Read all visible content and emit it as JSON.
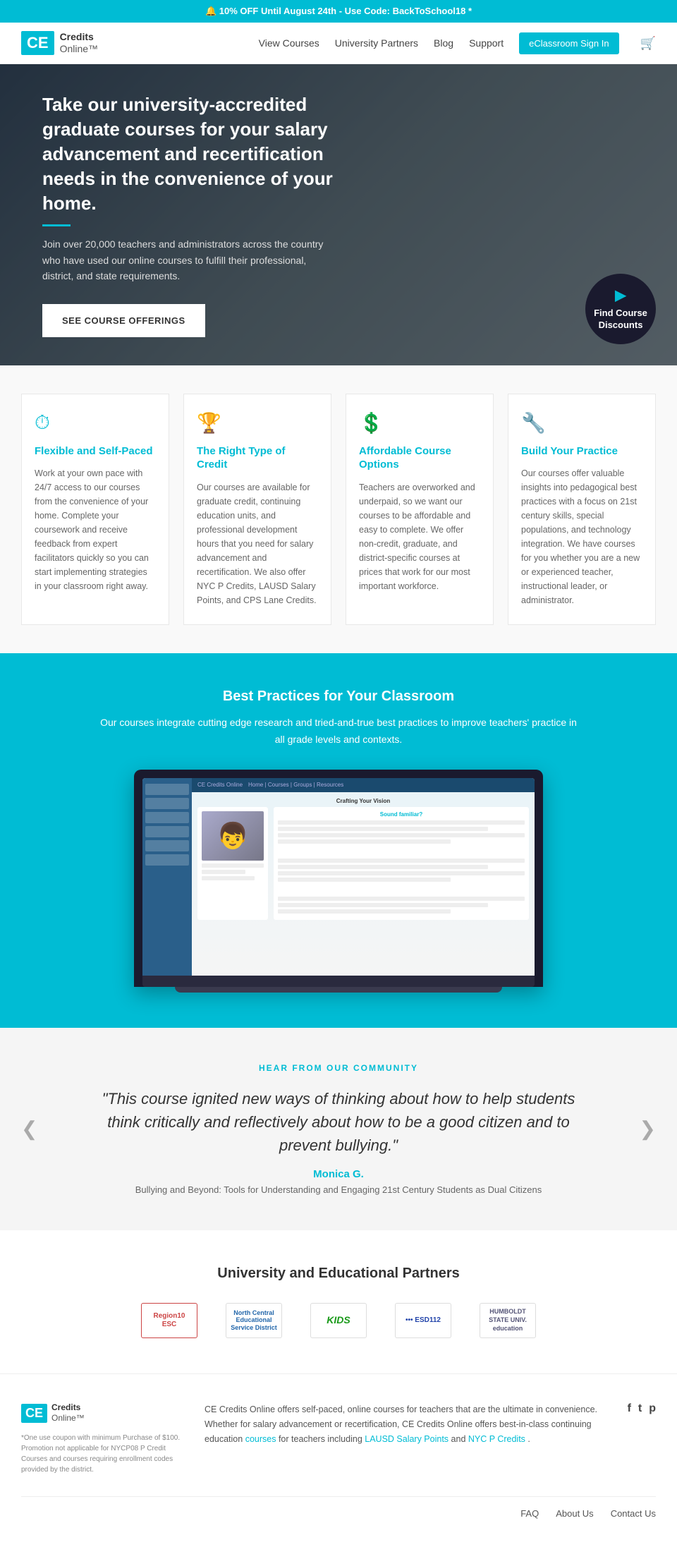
{
  "banner": {
    "text": "🔔 10% OFF Until August 24th - Use Code: BackToSchool18 *"
  },
  "header": {
    "logo_box": "CE",
    "logo_line1": "Credits",
    "logo_line2": "Online™",
    "nav": {
      "view_courses": "View Courses",
      "university_partners": "University Partners",
      "blog": "Blog",
      "support": "Support",
      "eclassroom": "eClassroom Sign In"
    }
  },
  "hero": {
    "headline": "Take our university-accredited graduate courses for your salary advancement and recertification needs in the convenience of your home.",
    "subtext": "Join over 20,000 teachers and administrators across the country who have used our online courses to fulfill their professional, district, and state requirements.",
    "cta_button": "SEE COURSE OFFERINGS",
    "badge_line1": "Find Course",
    "badge_line2": "Discounts"
  },
  "features": [
    {
      "icon": "⏱",
      "title": "Flexible and Self-Paced",
      "desc": "Work at your own pace with 24/7 access to our courses from the convenience of your home. Complete your coursework and receive feedback from expert facilitators quickly so you can start implementing strategies in your classroom right away."
    },
    {
      "icon": "🏆",
      "title": "The Right Type of Credit",
      "desc": "Our courses are available for graduate credit, continuing education units, and professional development hours that you need for salary advancement and recertification. We also offer NYC P Credits, LAUSD Salary Points, and CPS Lane Credits."
    },
    {
      "icon": "💲",
      "title": "Affordable Course Options",
      "desc": "Teachers are overworked and underpaid, so we want our courses to be affordable and easy to complete. We offer non-credit, graduate, and district-specific courses at prices that work for our most important workforce."
    },
    {
      "icon": "🔧",
      "title": "Build Your Practice",
      "desc": "Our courses offer valuable insights into pedagogical best practices with a focus on 21st century skills, special populations, and technology integration. We have courses for you whether you are a new or experienced teacher, instructional leader, or administrator."
    }
  ],
  "best_practices": {
    "title": "Best Practices for Your Classroom",
    "desc": "Our courses integrate cutting edge research and tried-and-true best practices to improve teachers' practice in all grade levels and contexts.",
    "screen_title": "Crafting Your Vision",
    "screen_subtitle": "Sound familiar?"
  },
  "testimonials": {
    "label": "HEAR FROM OUR COMMUNITY",
    "quote": "\"This course ignited new ways of thinking about how to help students think critically and reflectively about how to be a good citizen and to prevent bullying.\"",
    "author": "Monica G.",
    "course": "Bullying and Beyond: Tools for Understanding and Engaging 21st Century Students as Dual Citizens"
  },
  "partners": {
    "title": "University and Educational Partners",
    "logos": [
      {
        "name": "Region10 ESC",
        "label": "Region10\nESC"
      },
      {
        "name": "North Central Educational Service District",
        "label": "North Central\nEducational\nService District"
      },
      {
        "name": "KIDS",
        "label": "KIDS"
      },
      {
        "name": "ESD112",
        "label": "••• ESD112"
      },
      {
        "name": "Humboldt State University",
        "label": "HUMBOLDT\nSTATE UNIV.\neducation"
      }
    ]
  },
  "footer": {
    "logo_box": "CE",
    "logo_line1": "Credits",
    "logo_line2": "Online™",
    "disclaimer": "*One use coupon with minimum Purchase of $100. Promotion not applicable for NYCP08 P Credit Courses and courses requiring enrollment codes provided by the district.",
    "main_text_part1": "CE Credits Online offers self-paced, online courses for teachers that are the ultimate in convenience. Whether for salary advancement or recertification, CE Credits Online offers best-in-class continuing education ",
    "courses_link": "courses",
    "main_text_part2": " for teachers including ",
    "lausd_link": "LAUSD Salary Points",
    "main_text_part3": " and ",
    "nycp_link": "NYC P Credits",
    "main_text_part4": ".",
    "social": [
      "f",
      "t",
      "p"
    ],
    "links": [
      "FAQ",
      "About Us",
      "Contact Us"
    ]
  }
}
